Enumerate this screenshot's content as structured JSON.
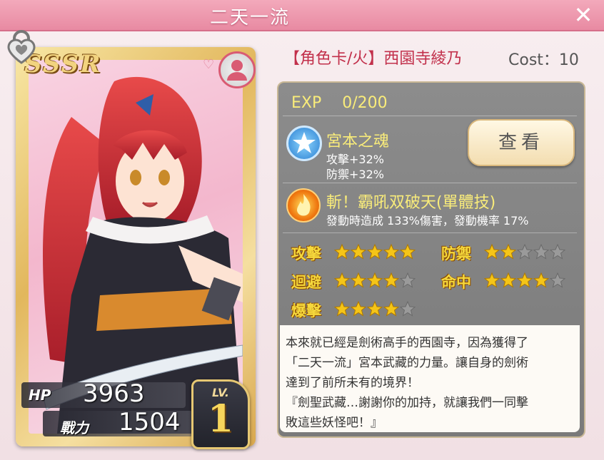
{
  "window": {
    "title": "二天一流",
    "close_icon": "close-icon"
  },
  "card": {
    "rarity": "SSSR",
    "hp_label": "HP",
    "hp_value": "3963",
    "power_label": "戰力",
    "power_value": "1504",
    "lv_label": "LV.",
    "lv_value": "1"
  },
  "info": {
    "type_label": "【角色卡/火】",
    "character_name": "西園寺綾乃",
    "cost": "Cost：10",
    "exp": "EXP　 0/200"
  },
  "skills": [
    {
      "icon": "star-badge-icon",
      "name": "宮本之魂",
      "lines": [
        "攻擊+32%",
        "防禦+32%"
      ]
    },
    {
      "icon": "flame-icon",
      "name": "斬！霸吼双破天(單體技)",
      "lines": [
        "發動時造成 133%傷害，發動機率 17%"
      ]
    }
  ],
  "view_button": "查看",
  "attributes": [
    {
      "label": "攻擊",
      "stars": 5
    },
    {
      "label": "防禦",
      "stars": 2
    },
    {
      "label": "迴避",
      "stars": 4
    },
    {
      "label": "命中",
      "stars": 4
    },
    {
      "label": "爆擊",
      "stars": 4
    }
  ],
  "max_stars": 5,
  "description": [
    "本來就已經是劍術高手的西園寺，因為獲得了",
    "「二天一流」宮本武藏的力量。讓自身的劍術",
    "達到了前所未有的境界！",
    "『劍聖武藏…謝謝你的加持，就讓我們一同擊",
    "敗這些妖怪吧！』"
  ],
  "colors": {
    "accent": "#c2304b",
    "star_on": "#f5c518",
    "star_off": "#9a9a9a",
    "title_bar": "#e88aa2"
  }
}
